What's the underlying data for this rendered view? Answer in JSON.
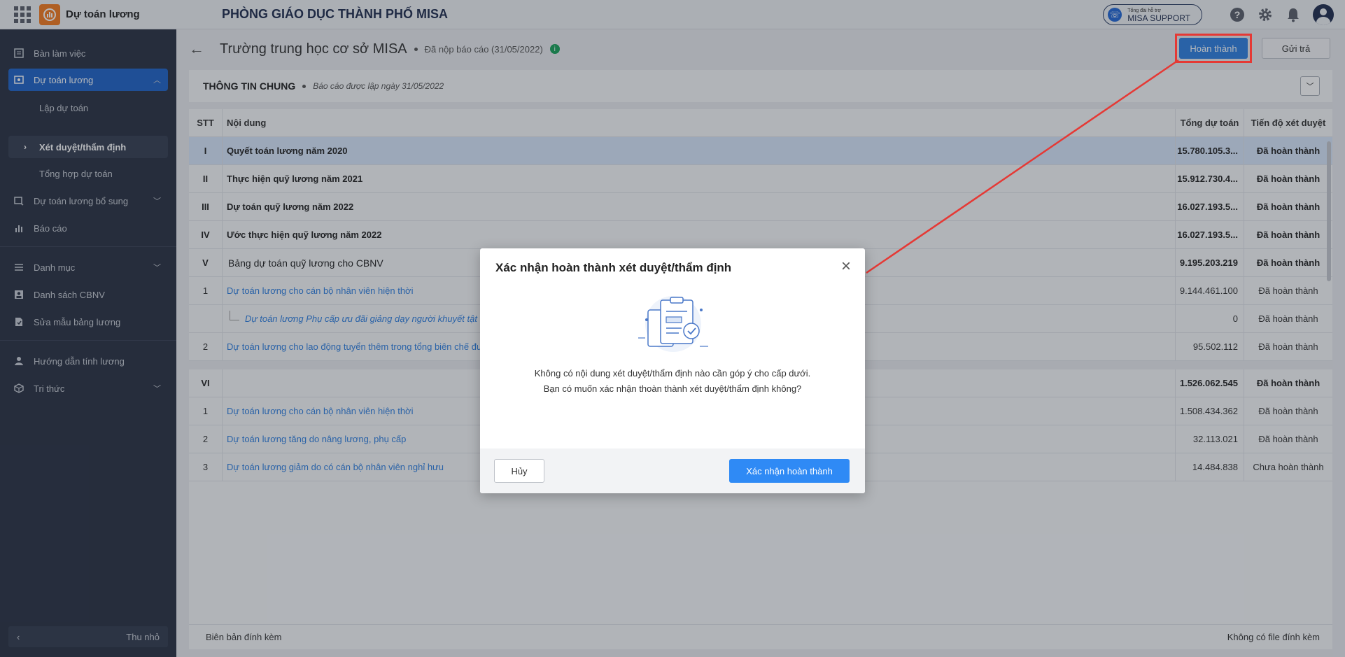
{
  "app": {
    "name": "Dự toán lương",
    "org": "PHÒNG GIÁO DỤC THÀNH PHỐ MISA"
  },
  "support": {
    "small": "Tổng đài hỗ trợ",
    "label": "MISA SUPPORT"
  },
  "sidebar": {
    "items": [
      {
        "label": "Bàn làm việc",
        "icon": "desk-icon"
      },
      {
        "label": "Dự toán lương",
        "icon": "budget-icon"
      },
      {
        "label": "Lập dự toán"
      },
      {
        "label": "Xét duyệt/thẩm định"
      },
      {
        "label": "Tổng hợp dự toán"
      },
      {
        "label": "Dự toán lương bổ sung",
        "icon": "supplement-icon"
      },
      {
        "label": "Báo cáo",
        "icon": "report-icon"
      },
      {
        "label": "Danh mục",
        "icon": "list-icon"
      },
      {
        "label": "Danh sách CBNV",
        "icon": "staff-icon"
      },
      {
        "label": "Sửa mẫu bảng lương",
        "icon": "template-icon"
      },
      {
        "label": "Hướng dẫn tính lương",
        "icon": "guide-icon"
      },
      {
        "label": "Tri thức",
        "icon": "knowledge-icon"
      }
    ],
    "collapse_label": "Thu nhỏ"
  },
  "page": {
    "title": "Trường trung học cơ sở MISA",
    "status": "Đã nộp báo cáo (31/05/2022)",
    "btn_done": "Hoàn thành",
    "btn_return": "Gửi trả"
  },
  "info": {
    "title": "THÔNG TIN CHUNG",
    "sub": "Báo cáo được lập ngày 31/05/2022"
  },
  "table": {
    "headers": {
      "stt": "STT",
      "nd": "Nội dung",
      "tong": "Tổng dự toán",
      "tien": "Tiến độ xét duyệt"
    },
    "rows": [
      {
        "stt": "I",
        "nd": "Quyết toán lương năm 2020",
        "tong": "15.780.105.3...",
        "tien": "Đã hoàn thành"
      },
      {
        "stt": "II",
        "nd": "Thực hiện quỹ lương năm 2021",
        "tong": "15.912.730.4...",
        "tien": "Đã hoàn thành"
      },
      {
        "stt": "III",
        "nd": "Dự toán quỹ lương năm 2022",
        "tong": "16.027.193.5...",
        "tien": "Đã hoàn thành"
      },
      {
        "stt": "IV",
        "nd": "Ước thực hiện quỹ lương năm 2022",
        "tong": "16.027.193.5...",
        "tien": "Đã hoàn thành"
      },
      {
        "stt": "V",
        "nd": "Bảng dự toán quỹ lương cho CBNV",
        "tong": "9.195.203.219",
        "tien": "Đã hoàn thành"
      },
      {
        "stt": "1",
        "nd": "Dự toán lương cho cán bộ nhân viên hiện thời",
        "tong": "9.144.461.100",
        "tien": "Đã hoàn thành"
      },
      {
        "stt": "",
        "nd": "Dự toán lương Phụ cấp ưu đãi giảng dạy người khuyết tật",
        "tong": "0",
        "tien": "Đã hoàn thành"
      },
      {
        "stt": "2",
        "nd": "Dự toán lương cho lao động tuyển thêm trong tổng biên chế được giao",
        "tong": "95.502.112",
        "tien": "Đã hoàn thành"
      }
    ],
    "rows2": [
      {
        "stt": "VI",
        "nd": "",
        "tong": "1.526.062.545",
        "tien": "Đã hoàn thành"
      },
      {
        "stt": "1",
        "nd": "Dự toán lương cho cán bộ nhân viên hiện thời",
        "tong": "1.508.434.362",
        "tien": "Đã hoàn thành"
      },
      {
        "stt": "2",
        "nd": "Dự toán lương tăng do nâng lương, phụ cấp",
        "tong": "32.113.021",
        "tien": "Đã hoàn thành"
      },
      {
        "stt": "3",
        "nd": "Dự toán lương giảm do có cán bộ nhân viên nghỉ hưu",
        "tong": "14.484.838",
        "tien": "Chưa hoàn thành"
      }
    ],
    "footer_left": "Biên bản đính kèm",
    "footer_right": "Không có file đính kèm"
  },
  "modal": {
    "title": "Xác nhận hoàn thành xét duyệt/thẩm định",
    "line1": "Không có nội dung xét duyệt/thẩm định nào cần góp ý cho cấp dưới.",
    "line2": "Bạn có muốn xác nhận thoàn thành xét duyệt/thẩm định không?",
    "cancel": "Hủy",
    "confirm": "Xác nhận hoàn thành"
  },
  "colors": {
    "accent": "#2f7fe0",
    "sidebar": "#2a3243",
    "highlight": "#e53935",
    "success": "#19a35b"
  }
}
